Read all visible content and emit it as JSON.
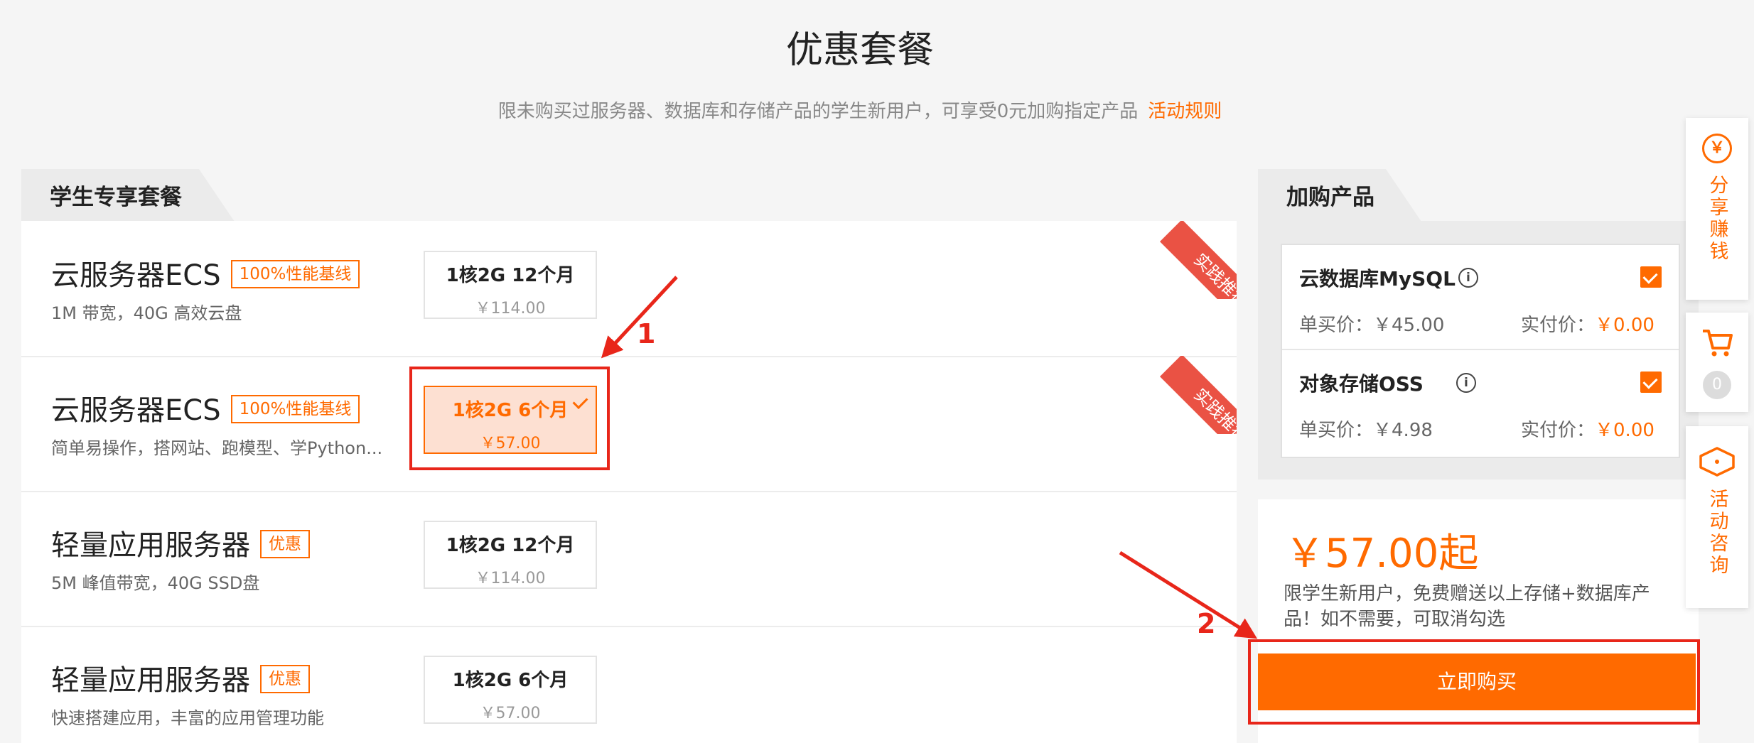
{
  "header": {
    "title": "优惠套餐",
    "subtitle": "限未购买过服务器、数据库和存储产品的学生新用户，可享受0元加购指定产品",
    "rules_link": "活动规则"
  },
  "left_panel": {
    "tab_label": "学生专享套餐",
    "packages": [
      {
        "name": "云服务器ECS",
        "badge": "100%性能基线",
        "desc": "1M 带宽，40G 高效云盘",
        "option_label": "1核2G 12个月",
        "option_price": "￥114.00",
        "selected": false,
        "ribbon": "实践推荐"
      },
      {
        "name": "云服务器ECS",
        "badge": "100%性能基线",
        "desc": "简单易操作，搭网站、跑模型、学Python...",
        "option_label": "1核2G 6个月",
        "option_price": "￥57.00",
        "selected": true,
        "ribbon": "实践推荐"
      },
      {
        "name": "轻量应用服务器",
        "badge": "优惠",
        "desc": "5M 峰值带宽，40G SSD盘",
        "option_label": "1核2G 12个月",
        "option_price": "￥114.00",
        "selected": false
      },
      {
        "name": "轻量应用服务器",
        "badge": "优惠",
        "desc": "快速搭建应用，丰富的应用管理功能",
        "option_label": "1核2G 6个月",
        "option_price": "￥57.00",
        "selected": false
      }
    ]
  },
  "right_panel": {
    "tab_label": "加购产品",
    "addons": [
      {
        "name": "云数据库MySQL",
        "unit_label": "单买价：",
        "unit_price": "￥45.00",
        "real_label": "实付价：",
        "real_price": "￥0.00",
        "checked": true
      },
      {
        "name": "对象存储OSS",
        "unit_label": "单买价：",
        "unit_price": "￥4.98",
        "real_label": "实付价：",
        "real_price": "￥0.00",
        "checked": true
      }
    ],
    "info_glyph": "i",
    "price": "￥57.00起",
    "note": "限学生新用户，免费赠送以上存储+数据库产品！如不需要，可取消勾选",
    "buy_button": "立即购买"
  },
  "annotations": {
    "step1": "1",
    "step2": "2",
    "color": "#e8261a"
  },
  "sidebar": {
    "share_icon": "￥",
    "share_label": "分享赚钱",
    "cart_count": "0",
    "consult_label": "活动咨询"
  },
  "colors": {
    "accent": "#ff6a00",
    "ribbon": "#ea5244"
  }
}
